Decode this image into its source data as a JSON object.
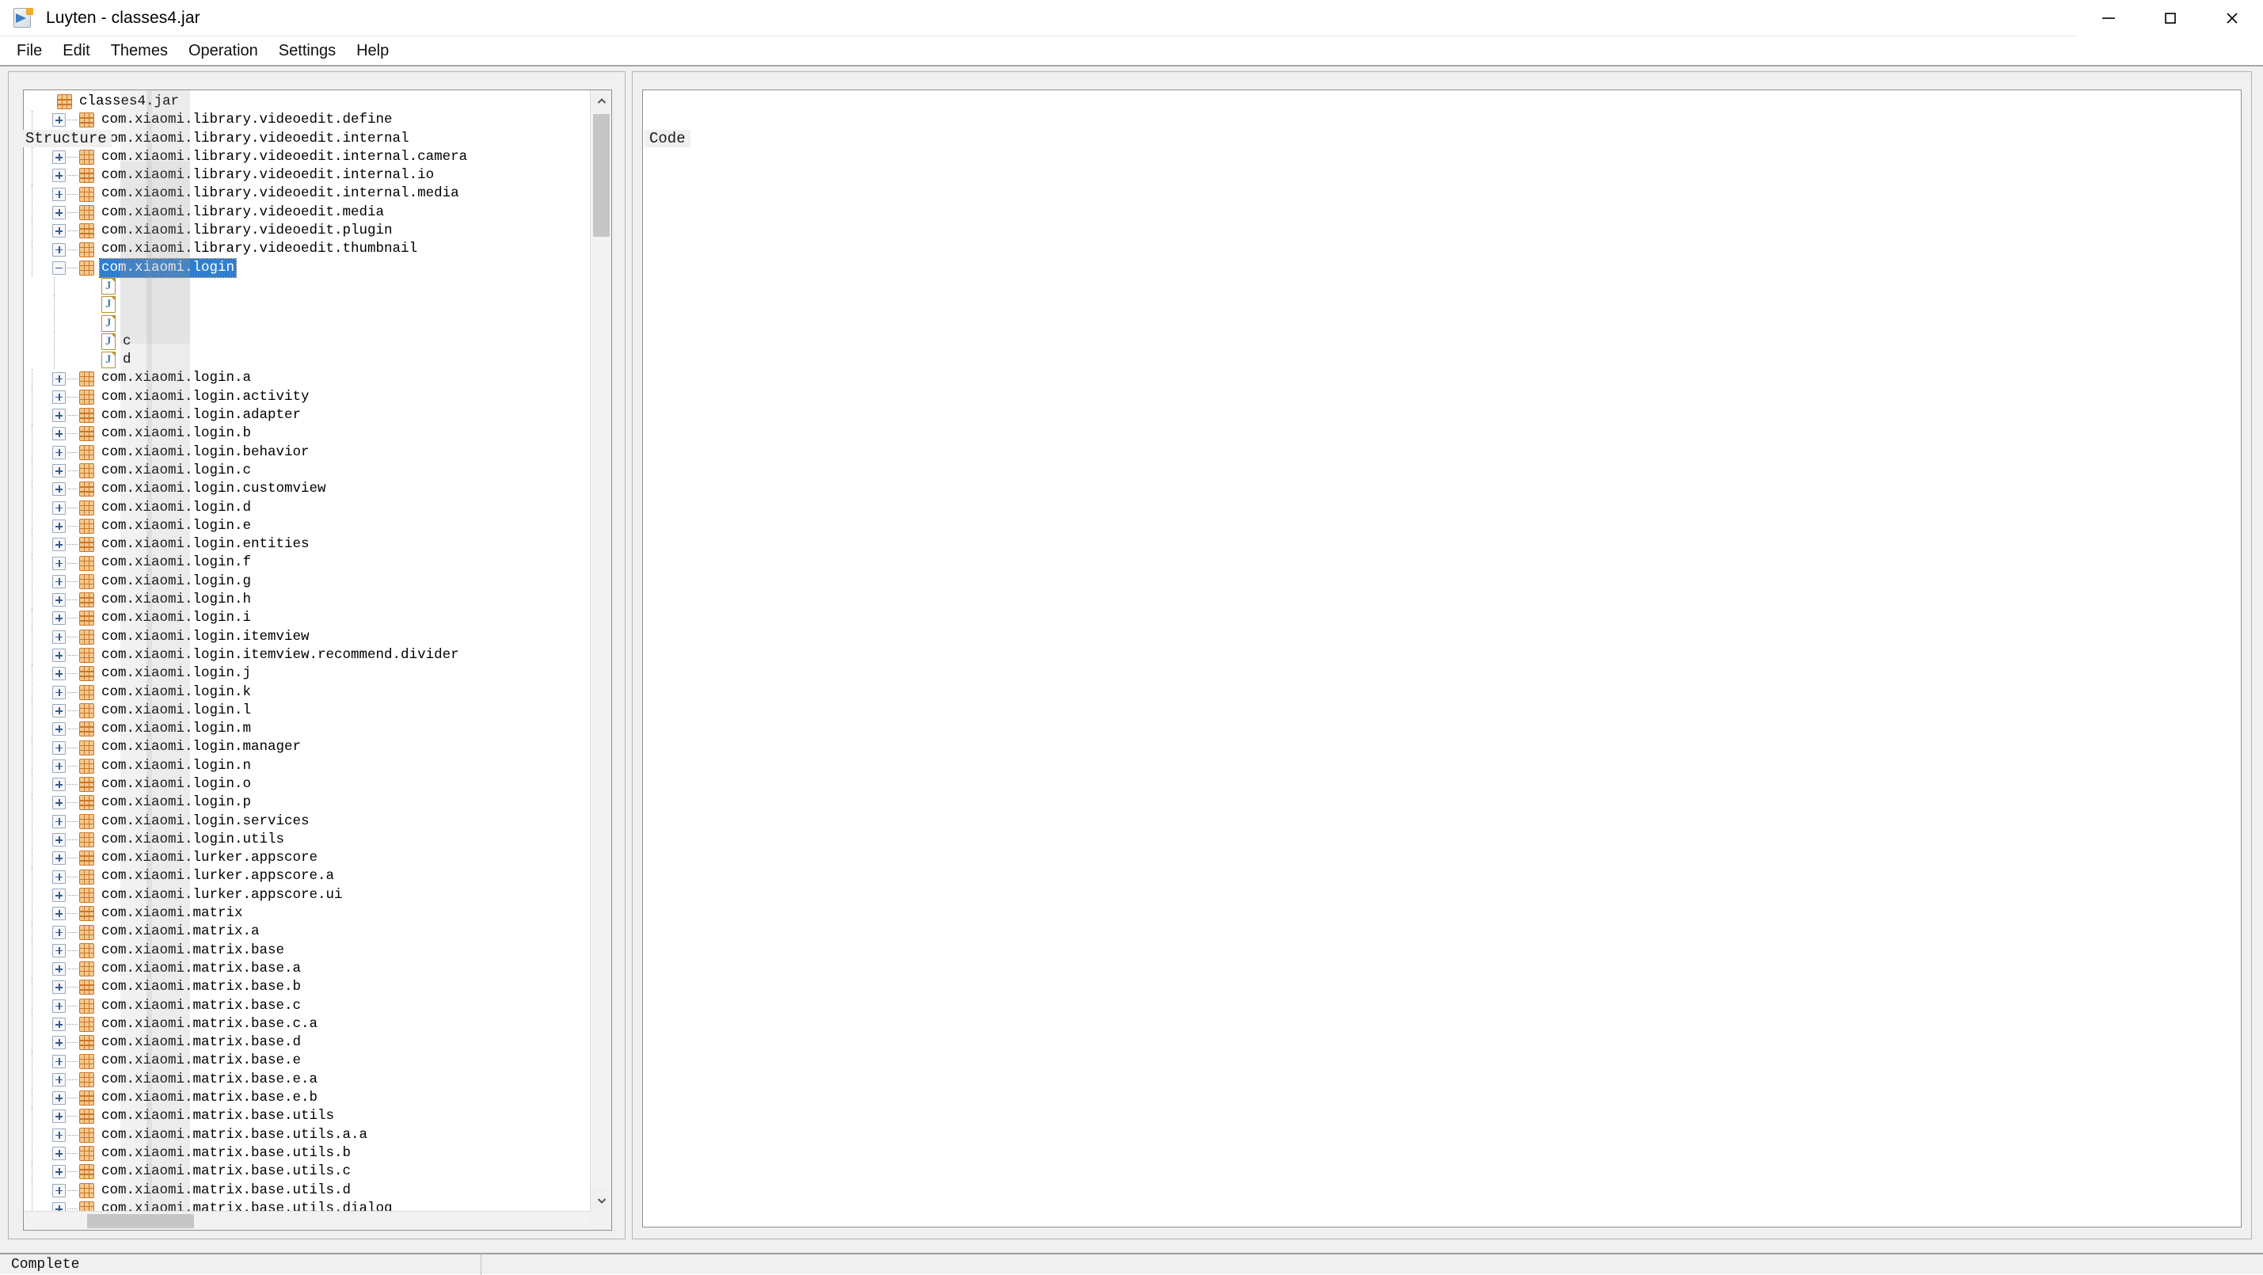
{
  "window": {
    "title": "Luyten - classes4.jar",
    "app_icon": "luyten-icon",
    "controls": [
      {
        "name": "minimize-button",
        "glyph": "minimize"
      },
      {
        "name": "maximize-button",
        "glyph": "maximize"
      },
      {
        "name": "close-button",
        "glyph": "close"
      }
    ]
  },
  "menubar": {
    "items": [
      "File",
      "Edit",
      "Themes",
      "Operation",
      "Settings",
      "Help"
    ]
  },
  "structure": {
    "title": "Structure",
    "root": "classes4.jar",
    "rows": [
      {
        "depth": 0,
        "toggle": "none",
        "icon": "package",
        "label": "classes4.jar"
      },
      {
        "depth": 1,
        "toggle": "plus",
        "icon": "package",
        "label": "com.xiaomi.library.videoedit.define"
      },
      {
        "depth": 1,
        "toggle": "plus",
        "icon": "package",
        "label": "com.xiaomi.library.videoedit.internal"
      },
      {
        "depth": 1,
        "toggle": "plus",
        "icon": "package",
        "label": "com.xiaomi.library.videoedit.internal.camera"
      },
      {
        "depth": 1,
        "toggle": "plus",
        "icon": "package",
        "label": "com.xiaomi.library.videoedit.internal.io"
      },
      {
        "depth": 1,
        "toggle": "plus",
        "icon": "package",
        "label": "com.xiaomi.library.videoedit.internal.media"
      },
      {
        "depth": 1,
        "toggle": "plus",
        "icon": "package",
        "label": "com.xiaomi.library.videoedit.media"
      },
      {
        "depth": 1,
        "toggle": "plus",
        "icon": "package",
        "label": "com.xiaomi.library.videoedit.plugin"
      },
      {
        "depth": 1,
        "toggle": "plus",
        "icon": "package",
        "label": "com.xiaomi.library.videoedit.thumbnail"
      },
      {
        "depth": 1,
        "toggle": "minus",
        "icon": "package",
        "label": "com.xiaomi.login",
        "selected": true
      },
      {
        "depth": 2,
        "toggle": "none",
        "icon": "java",
        "label": ""
      },
      {
        "depth": 2,
        "toggle": "none",
        "icon": "java",
        "label": ""
      },
      {
        "depth": 2,
        "toggle": "none",
        "icon": "java",
        "label": ""
      },
      {
        "depth": 2,
        "toggle": "none",
        "icon": "java",
        "label": "c"
      },
      {
        "depth": 2,
        "toggle": "none",
        "icon": "java",
        "label": "d"
      },
      {
        "depth": 1,
        "toggle": "plus",
        "icon": "package",
        "label": "com.xiaomi.login.a"
      },
      {
        "depth": 1,
        "toggle": "plus",
        "icon": "package",
        "label": "com.xiaomi.login.activity"
      },
      {
        "depth": 1,
        "toggle": "plus",
        "icon": "package",
        "label": "com.xiaomi.login.adapter"
      },
      {
        "depth": 1,
        "toggle": "plus",
        "icon": "package",
        "label": "com.xiaomi.login.b"
      },
      {
        "depth": 1,
        "toggle": "plus",
        "icon": "package",
        "label": "com.xiaomi.login.behavior"
      },
      {
        "depth": 1,
        "toggle": "plus",
        "icon": "package",
        "label": "com.xiaomi.login.c"
      },
      {
        "depth": 1,
        "toggle": "plus",
        "icon": "package",
        "label": "com.xiaomi.login.customview"
      },
      {
        "depth": 1,
        "toggle": "plus",
        "icon": "package",
        "label": "com.xiaomi.login.d"
      },
      {
        "depth": 1,
        "toggle": "plus",
        "icon": "package",
        "label": "com.xiaomi.login.e"
      },
      {
        "depth": 1,
        "toggle": "plus",
        "icon": "package",
        "label": "com.xiaomi.login.entities"
      },
      {
        "depth": 1,
        "toggle": "plus",
        "icon": "package",
        "label": "com.xiaomi.login.f"
      },
      {
        "depth": 1,
        "toggle": "plus",
        "icon": "package",
        "label": "com.xiaomi.login.g"
      },
      {
        "depth": 1,
        "toggle": "plus",
        "icon": "package",
        "label": "com.xiaomi.login.h"
      },
      {
        "depth": 1,
        "toggle": "plus",
        "icon": "package",
        "label": "com.xiaomi.login.i"
      },
      {
        "depth": 1,
        "toggle": "plus",
        "icon": "package",
        "label": "com.xiaomi.login.itemview"
      },
      {
        "depth": 1,
        "toggle": "plus",
        "icon": "package",
        "label": "com.xiaomi.login.itemview.recommend.divider"
      },
      {
        "depth": 1,
        "toggle": "plus",
        "icon": "package",
        "label": "com.xiaomi.login.j"
      },
      {
        "depth": 1,
        "toggle": "plus",
        "icon": "package",
        "label": "com.xiaomi.login.k"
      },
      {
        "depth": 1,
        "toggle": "plus",
        "icon": "package",
        "label": "com.xiaomi.login.l"
      },
      {
        "depth": 1,
        "toggle": "plus",
        "icon": "package",
        "label": "com.xiaomi.login.m"
      },
      {
        "depth": 1,
        "toggle": "plus",
        "icon": "package",
        "label": "com.xiaomi.login.manager"
      },
      {
        "depth": 1,
        "toggle": "plus",
        "icon": "package",
        "label": "com.xiaomi.login.n"
      },
      {
        "depth": 1,
        "toggle": "plus",
        "icon": "package",
        "label": "com.xiaomi.login.o"
      },
      {
        "depth": 1,
        "toggle": "plus",
        "icon": "package",
        "label": "com.xiaomi.login.p"
      },
      {
        "depth": 1,
        "toggle": "plus",
        "icon": "package",
        "label": "com.xiaomi.login.services"
      },
      {
        "depth": 1,
        "toggle": "plus",
        "icon": "package",
        "label": "com.xiaomi.login.utils"
      },
      {
        "depth": 1,
        "toggle": "plus",
        "icon": "package",
        "label": "com.xiaomi.lurker.appscore"
      },
      {
        "depth": 1,
        "toggle": "plus",
        "icon": "package",
        "label": "com.xiaomi.lurker.appscore.a"
      },
      {
        "depth": 1,
        "toggle": "plus",
        "icon": "package",
        "label": "com.xiaomi.lurker.appscore.ui"
      },
      {
        "depth": 1,
        "toggle": "plus",
        "icon": "package",
        "label": "com.xiaomi.matrix"
      },
      {
        "depth": 1,
        "toggle": "plus",
        "icon": "package",
        "label": "com.xiaomi.matrix.a"
      },
      {
        "depth": 1,
        "toggle": "plus",
        "icon": "package",
        "label": "com.xiaomi.matrix.base"
      },
      {
        "depth": 1,
        "toggle": "plus",
        "icon": "package",
        "label": "com.xiaomi.matrix.base.a"
      },
      {
        "depth": 1,
        "toggle": "plus",
        "icon": "package",
        "label": "com.xiaomi.matrix.base.b"
      },
      {
        "depth": 1,
        "toggle": "plus",
        "icon": "package",
        "label": "com.xiaomi.matrix.base.c"
      },
      {
        "depth": 1,
        "toggle": "plus",
        "icon": "package",
        "label": "com.xiaomi.matrix.base.c.a"
      },
      {
        "depth": 1,
        "toggle": "plus",
        "icon": "package",
        "label": "com.xiaomi.matrix.base.d"
      },
      {
        "depth": 1,
        "toggle": "plus",
        "icon": "package",
        "label": "com.xiaomi.matrix.base.e"
      },
      {
        "depth": 1,
        "toggle": "plus",
        "icon": "package",
        "label": "com.xiaomi.matrix.base.e.a"
      },
      {
        "depth": 1,
        "toggle": "plus",
        "icon": "package",
        "label": "com.xiaomi.matrix.base.e.b"
      },
      {
        "depth": 1,
        "toggle": "plus",
        "icon": "package",
        "label": "com.xiaomi.matrix.base.utils"
      },
      {
        "depth": 1,
        "toggle": "plus",
        "icon": "package",
        "label": "com.xiaomi.matrix.base.utils.a.a"
      },
      {
        "depth": 1,
        "toggle": "plus",
        "icon": "package",
        "label": "com.xiaomi.matrix.base.utils.b"
      },
      {
        "depth": 1,
        "toggle": "plus",
        "icon": "package",
        "label": "com.xiaomi.matrix.base.utils.c"
      },
      {
        "depth": 1,
        "toggle": "plus",
        "icon": "package",
        "label": "com.xiaomi.matrix.base.utils.d"
      },
      {
        "depth": 1,
        "toggle": "plus",
        "icon": "package",
        "label": "com.xiaomi.matrix.base.utils.dialog"
      }
    ]
  },
  "code": {
    "title": "Code",
    "content": ""
  },
  "statusbar": {
    "message": "Complete"
  },
  "colors": {
    "selection": "#2f7fd1",
    "package_icon": "#c9762a",
    "window_bg": "#f0f0f0"
  }
}
